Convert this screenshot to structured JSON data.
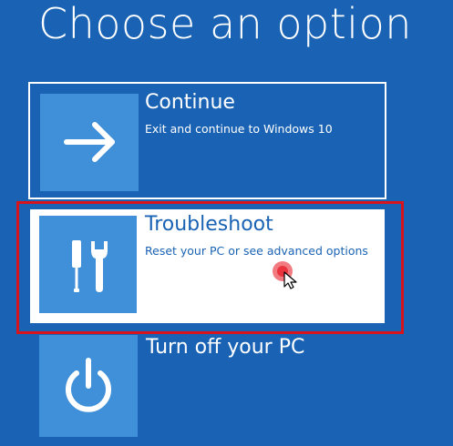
{
  "page": {
    "title": "Choose an option"
  },
  "options": [
    {
      "id": "continue",
      "title": "Continue",
      "subtitle": "Exit and continue to Windows 10",
      "icon": "arrow-right-icon"
    },
    {
      "id": "troubleshoot",
      "title": "Troubleshoot",
      "subtitle": "Reset your PC or see advanced options",
      "icon": "tools-icon",
      "selected": true
    },
    {
      "id": "turn-off",
      "title": "Turn off your PC",
      "icon": "power-icon"
    }
  ],
  "annotation": {
    "highlight_color": "#d6141e",
    "highlighted_option": "troubleshoot"
  },
  "cursor": {
    "icon": "mouse-pointer-icon",
    "click_marker_color": "#e8232c"
  },
  "colors": {
    "background": "#1a63b4",
    "tile": "#3f8fd9",
    "text": "#ffffff",
    "selected_background": "#ffffff",
    "selected_text": "#1a63b4"
  }
}
